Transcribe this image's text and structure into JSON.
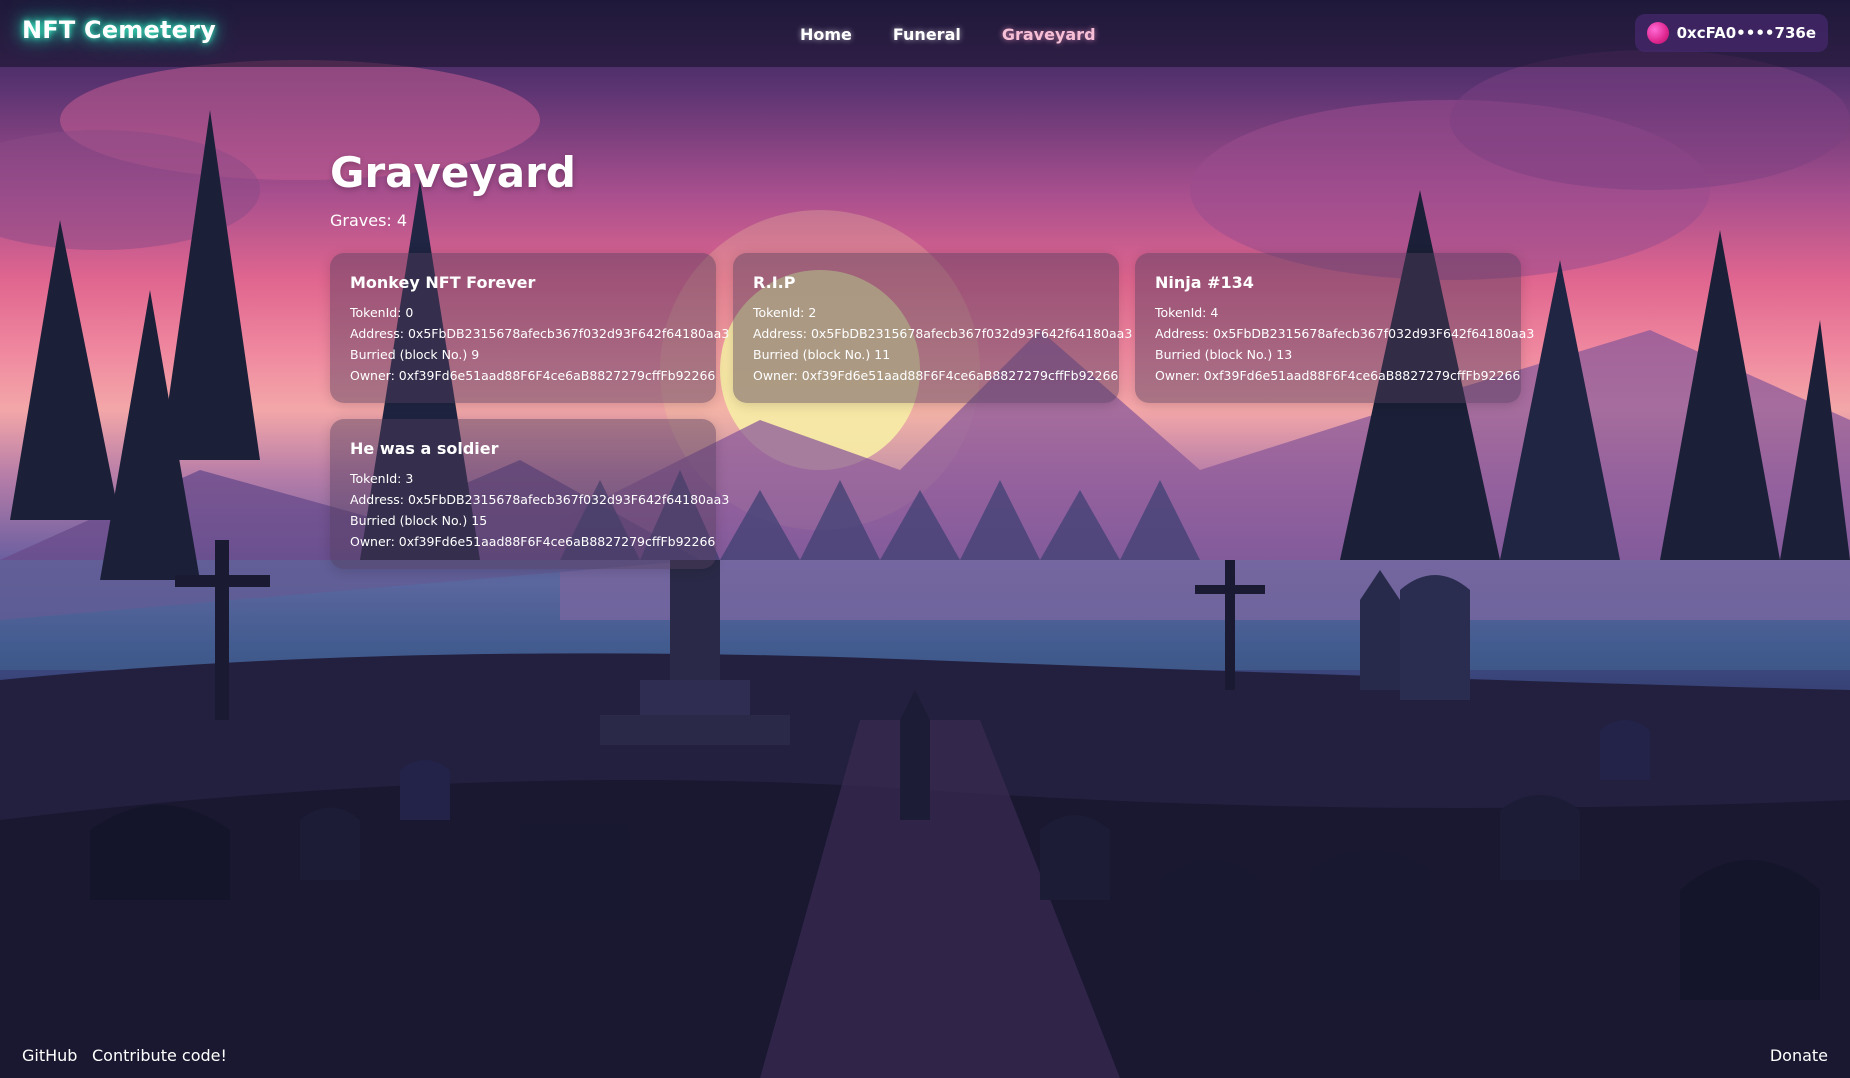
{
  "header": {
    "brand": "NFT Cemetery",
    "nav": [
      {
        "label": "Home",
        "active": false
      },
      {
        "label": "Funeral",
        "active": false
      },
      {
        "label": "Graveyard",
        "active": true
      }
    ],
    "wallet": {
      "address": "0xcFA0••••736e"
    }
  },
  "main": {
    "title": "Graveyard",
    "graves_label": "Graves:",
    "graves_count": "4"
  },
  "labels": {
    "token": "TokenId:",
    "address": "Address:",
    "block": "Burried (block No.)",
    "owner": "Owner:"
  },
  "graves": [
    {
      "name": "Monkey NFT Forever",
      "token_id": "0",
      "address": "0x5FbDB2315678afecb367f032d93F642f64180aa3",
      "block": "9",
      "owner": "0xf39Fd6e51aad88F6F4ce6aB8827279cffFb92266"
    },
    {
      "name": "R.I.P",
      "token_id": "2",
      "address": "0x5FbDB2315678afecb367f032d93F642f64180aa3",
      "block": "11",
      "owner": "0xf39Fd6e51aad88F6F4ce6aB8827279cffFb92266"
    },
    {
      "name": "Ninja #134",
      "token_id": "4",
      "address": "0x5FbDB2315678afecb367f032d93F642f64180aa3",
      "block": "13",
      "owner": "0xf39Fd6e51aad88F6F4ce6aB8827279cffFb92266"
    },
    {
      "name": "He was a soldier",
      "token_id": "3",
      "address": "0x5FbDB2315678afecb367f032d93F642f64180aa3",
      "block": "15",
      "owner": "0xf39Fd6e51aad88F6F4ce6aB8827279cffFb92266"
    }
  ],
  "footer": {
    "github": "GitHub",
    "contribute": "Contribute code!",
    "donate": "Donate"
  },
  "colors": {
    "brand_glow": "#3cf2c8",
    "active_nav": "#f6bfd6",
    "wallet_bg": "#46286e",
    "avatar": "#e0268f"
  }
}
